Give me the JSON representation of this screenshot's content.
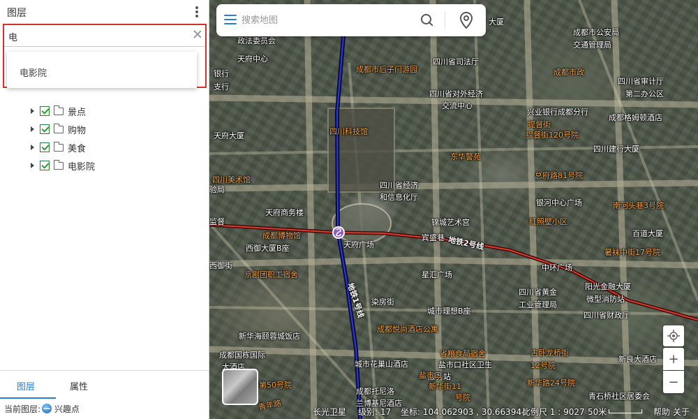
{
  "panel": {
    "title": "图层",
    "search_value": "电",
    "suggestions": [
      "电影院"
    ],
    "tree": [
      {
        "label": "景点"
      },
      {
        "label": "购物"
      },
      {
        "label": "美食"
      },
      {
        "label": "电影院"
      }
    ],
    "tabs": {
      "layers": "图层",
      "properties": "属性"
    },
    "status": {
      "current_layer_label": "当前图层:",
      "current_layer_value": "兴趣点"
    }
  },
  "map": {
    "search_placeholder": "搜索地图",
    "labels": {
      "l1": "政法委员会",
      "l2": "天府中心",
      "l3": "成都市后子门游园",
      "l4": "四川省司法厅",
      "l5": "四川省对外经济",
      "l6": "交流中心",
      "l7": "兴业银行成都分行",
      "l8": "成都格姆顿酒店",
      "l9": "四川科技馆",
      "l10": "东华警苑",
      "l11": "四川建行大厦",
      "l12": "四川美术馆",
      "l13": "四川省经济",
      "l14": "和信息化厅",
      "l15": "天府商务楼",
      "l16": "锦城艺术宫",
      "l17": "银河中心广场",
      "l18": "成都博物馆",
      "l19": "天府广场",
      "l20": "宾盛巷",
      "l21": "地铁2号线",
      "l22": "西御大厦B座",
      "l23": "中环广场",
      "l24": "阳光金融大厦",
      "l25": "星汇广场",
      "l26": "京剧团职工宿舍",
      "l27": "四川省黄金",
      "l28": "工业管理局",
      "l29": "微型消防站",
      "l30": "四川省财政厅",
      "l31": "染房街",
      "l32": "城市理想B座",
      "l33": "地铁1号线",
      "l34": "新华海颐蓉城饭店",
      "l35": "成都国栋国际",
      "l36": "大酒店",
      "l37": "城市花巢山酒店",
      "l38": "盐市口社区卫生",
      "l39": "服务站",
      "l40": "新良大酒店",
      "l41": "成都托尼洛",
      "l42": "兰博基尼酒店",
      "l43": "青石桥社区居委会",
      "l44": "成都市公安局",
      "l45": "交通管理局",
      "l46": "四川省审计厅",
      "l47": "第二办公区",
      "l48": "四川大厦",
      "l49": "银行",
      "l50": "支行",
      "l51": "天府大厦",
      "l52": "验局",
      "l53": "监督",
      "l54": "西御街",
      "l55": "百道大厦",
      "l56": "红照壁小区",
      "l57": "成都悦尚酒店公寓",
      "l58": "提督街120号院",
      "l59": "总府路81号院",
      "l60": "南河头巷3号院",
      "l61": "暑袜中街17号院",
      "l62": "古卧龙桥街",
      "l63": "12号院",
      "l64": "新华路24号院",
      "l65": "盐市口",
      "l66": "新华街11",
      "l67": "号院",
      "l68": "路第50号院",
      "l69": "提督街",
      "l70": "成都市政",
      "l71": "省粮食局宿舍",
      "l72": "大厦",
      "l73": "青年路"
    },
    "status": {
      "source": "长光卫星",
      "level": "级别: 17",
      "coords": "坐标: 104.062903 , 30.663944",
      "scale": "比例尺 1 : 9027",
      "scale_len": "50米",
      "help": "帮助",
      "about": "关于"
    }
  }
}
